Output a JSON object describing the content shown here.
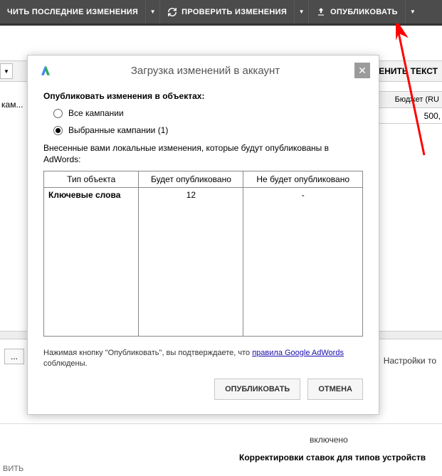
{
  "toolbar": {
    "btn1": "ЧИТЬ ПОСЛЕДНИЕ ИЗМЕНЕНИЯ",
    "btn2": "ПРОВЕРИТЬ ИЗМЕНЕНИЯ",
    "btn3": "ОПУБЛИКОВАТЬ"
  },
  "background": {
    "change_text": "ЕНИТЬ ТЕКСТ",
    "left_truncated": "кам...",
    "budget_label": "Бюджет (RU",
    "budget_value": "500,",
    "settings_truncated": "Настройки то",
    "tab_dots": "...",
    "status_on": "включено",
    "device_section": "Корректировки ставок для типов устройств",
    "footer_left": "ВИТЬ"
  },
  "dialog": {
    "title": "Загрузка изменений в аккаунт",
    "section_header": "Опубликовать изменения в объектах:",
    "radio_all": "Все кампании",
    "radio_selected": "Выбранные кампании (1)",
    "desc": "Внесенные вами локальные изменения, которые будут опубликованы в AdWords:",
    "col1": "Тип объекта",
    "col2": "Будет опубликовано",
    "col3": "Не будет опубликовано",
    "row_label": "Ключевые слова",
    "row_v1": "12",
    "row_v2": "-",
    "agree_pre": "Нажимая кнопку \"Опубликовать\", вы подтверждаете, что ",
    "agree_link": "правила Google AdWords",
    "agree_post": " соблюдены.",
    "ok": "ОПУБЛИКОВАТЬ",
    "cancel": "ОТМЕНА"
  }
}
